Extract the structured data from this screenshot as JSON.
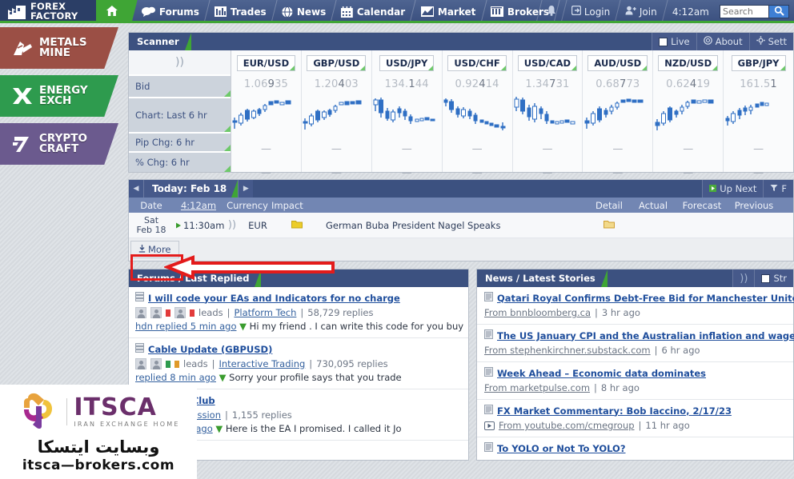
{
  "topbar": {
    "logo_line1": "FOREX",
    "logo_line2": "FACTORY",
    "home_icon": "home-icon",
    "nav": [
      {
        "label": "Forums",
        "icon": "chat-bubble-icon"
      },
      {
        "label": "Trades",
        "icon": "bar-chart-icon"
      },
      {
        "label": "News",
        "icon": "globe-icon"
      },
      {
        "label": "Calendar",
        "icon": "calendar-icon"
      },
      {
        "label": "Market",
        "icon": "line-chart-icon"
      },
      {
        "label": "Brokers",
        "icon": "building-icon"
      }
    ],
    "bell_icon": "bell-icon",
    "login": "Login",
    "join": "Join",
    "time": "4:12am",
    "search_placeholder": "Search",
    "search_value": "",
    "search_icon": "magnifier-icon"
  },
  "sidebar": {
    "items": [
      {
        "line1": "METALS",
        "line2": "MINE",
        "color": "#9b4f45",
        "icon": "metals-mine-icon"
      },
      {
        "line1": "ENERGY",
        "line2": "EXCH",
        "color": "#2e9b4e",
        "icon": "energy-exch-icon"
      },
      {
        "line1": "CRYPTO",
        "line2": "CRAFT",
        "color": "#6b5a8e",
        "icon": "crypto-craft-icon"
      }
    ]
  },
  "scanner": {
    "title": "Scanner",
    "live_label": "Live",
    "live_checked": false,
    "about_label": "About",
    "settings_label": "Sett",
    "sound_icon": "sound-icon",
    "row_labels": [
      "Bid",
      "Chart: Last 6 hr",
      "Pip Chg: 6 hr",
      "% Chg: 6 hr"
    ],
    "empty_value": "—",
    "pairs": [
      {
        "pair": "EUR/USD",
        "bid_light": "1.06",
        "bid_bold": "9",
        "bid_rest": "35",
        "pip_chg": "—",
        "pct_chg": "—"
      },
      {
        "pair": "GBP/USD",
        "bid_light": "1.20",
        "bid_bold": "4",
        "bid_rest": "03",
        "pip_chg": "—",
        "pct_chg": "—"
      },
      {
        "pair": "USD/JPY",
        "bid_light": "134.",
        "bid_bold": "1",
        "bid_rest": "44",
        "pip_chg": "—",
        "pct_chg": "—"
      },
      {
        "pair": "USD/CHF",
        "bid_light": "0.92",
        "bid_bold": "4",
        "bid_rest": "14",
        "pip_chg": "—",
        "pct_chg": "—"
      },
      {
        "pair": "USD/CAD",
        "bid_light": "1.34",
        "bid_bold": "7",
        "bid_rest": "31",
        "pip_chg": "—",
        "pct_chg": "—"
      },
      {
        "pair": "AUD/USD",
        "bid_light": "0.68",
        "bid_bold": "7",
        "bid_rest": "73",
        "pip_chg": "—",
        "pct_chg": "—"
      },
      {
        "pair": "NZD/USD",
        "bid_light": "0.62",
        "bid_bold": "4",
        "bid_rest": "19",
        "pip_chg": "—",
        "pct_chg": "—"
      },
      {
        "pair": "GBP/JPY",
        "bid_light": "161.5",
        "bid_bold": "1",
        "bid_rest": "",
        "pip_chg": "—",
        "pct_chg": "—"
      }
    ]
  },
  "calendar": {
    "prev_arrow": "◀",
    "next_arrow": "▶",
    "today_label": "Today: Feb 18",
    "up_next": "Up Next",
    "filter_label": "F",
    "columns": {
      "date": "Date",
      "time": "4:12am",
      "currency": "Currency",
      "impact": "Impact",
      "detail": "Detail",
      "actual": "Actual",
      "forecast": "Forecast",
      "previous": "Previous"
    },
    "rows": [
      {
        "date_line1": "Sat",
        "date_line2": "Feb 18",
        "time": "11:30am",
        "currency": "EUR",
        "impact_color": "#e8c11f",
        "event": "German Buba President Nagel Speaks",
        "actual": "",
        "forecast": "",
        "previous": ""
      }
    ],
    "more_label": "More"
  },
  "forums": {
    "title": "Forums / Last Replied",
    "threads": [
      {
        "title": "I will code your EAs and Indicators for no charge",
        "badge": "leads",
        "category": "Platform Tech",
        "replies": "58,729 replies",
        "last_reply": "hdn replied 5 min ago",
        "preview": "Hi my friend . I can write this code for you buy"
      },
      {
        "title": "Cable Update (GBPUSD)",
        "badge": "leads",
        "category": "Interactive Trading",
        "replies": "730,095 replies",
        "last_reply": "replied 8 min ago",
        "preview": "Sorry your profile says that you trade"
      },
      {
        "title": "ce Book Club",
        "badge": "",
        "category": "Trading Discussion",
        "replies": "1,155 replies",
        "last_reply": "plied 13 min ago",
        "preview": "Here is the EA I promised. I called it Jo"
      }
    ]
  },
  "news": {
    "title": "News / Latest Stories",
    "sound_icon": "sound-icon",
    "stream_label": "Str",
    "stream_checked": false,
    "stories": [
      {
        "title": "Qatari Royal Confirms Debt-Free Bid for Manchester United",
        "source": "From bnnbloomberg.ca",
        "age": "3 hr ago",
        "video": false
      },
      {
        "title": "The US January CPI and the Australian inflation and wage",
        "source": "From stephenkirchner.substack.com",
        "age": "6 hr ago",
        "video": false
      },
      {
        "title": "Week Ahead – Economic data dominates",
        "source": "From marketpulse.com",
        "age": "8 hr ago",
        "video": false
      },
      {
        "title": "FX Market Commentary: Bob Iaccino, 2/17/23",
        "source": "From youtube.com/cmegroup",
        "age": "11 hr ago",
        "video": true
      },
      {
        "title": "To YOLO or Not To YOLO?",
        "source": "",
        "age": "",
        "video": false
      }
    ]
  },
  "watermark": {
    "brand": "ITSCA",
    "tagline": "IRAN EXCHANGE HOME",
    "farsi": "وبسایت ایتسکا",
    "url": "itsca—brokers.com"
  },
  "colors": {
    "accent_green": "#3fa535",
    "header_blue": "#3c5180",
    "link_blue": "#1f4e9c",
    "annotation_red": "#e31b1b"
  }
}
